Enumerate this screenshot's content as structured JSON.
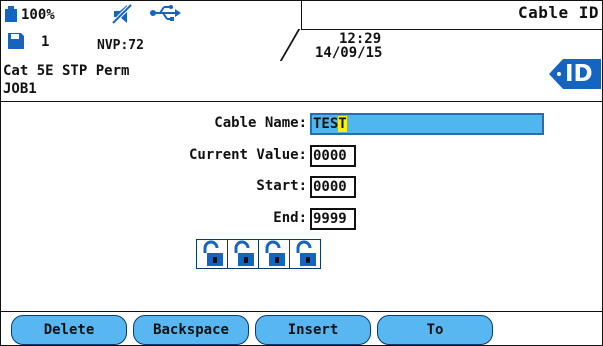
{
  "status": {
    "battery_percent": "100%",
    "battery_icon": "battery-icon",
    "muted_icon": "speaker-muted-icon",
    "usb_icon": "usb-icon",
    "disk_icon": "disk-icon",
    "job_number": "1",
    "nvp": "NVP:72",
    "time": "12:29",
    "date": "14/09/15",
    "title": "Cable ID"
  },
  "context": {
    "cable_type": "Cat 5E STP Perm",
    "job_name": "JOB1",
    "badge_text": "ID"
  },
  "form": {
    "cable_name": {
      "label": "Cable Name:",
      "value": "TES",
      "cursor_char": "T"
    },
    "current_value": {
      "label": "Current Value:",
      "value": "0000"
    },
    "start": {
      "label": "Start:",
      "value": "0000"
    },
    "end": {
      "label": "End:",
      "value": "9999"
    },
    "locks": [
      "unlocked",
      "unlocked",
      "unlocked",
      "unlocked"
    ],
    "lock_icon": "unlocked-padlock-icon"
  },
  "softkeys": [
    "Delete",
    "Backspace",
    "Insert",
    "To"
  ],
  "colors": {
    "accent": "#1565c0",
    "field_highlight": "#4fb7ee",
    "cursor": "#fff200",
    "softkey": "#58b6f0"
  }
}
